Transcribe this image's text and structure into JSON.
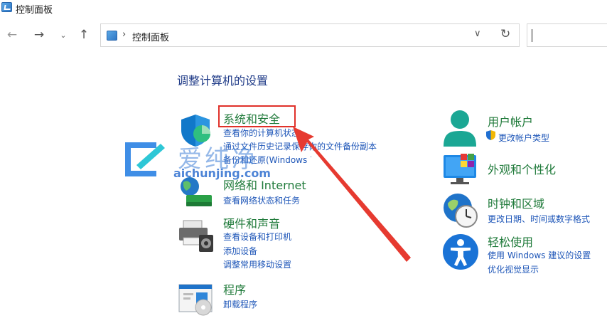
{
  "window": {
    "title": "控制面板"
  },
  "address": {
    "path": "控制面板"
  },
  "heading": "调整计算机的设置",
  "left": [
    {
      "title": "系统和安全",
      "links": [
        "查看你的计算机状态",
        "通过文件历史记录保存你的文件备份副本",
        "备份和还原(Windows 7)"
      ]
    },
    {
      "title": "网络和 Internet",
      "links": [
        "查看网络状态和任务"
      ]
    },
    {
      "title": "硬件和声音",
      "links": [
        "查看设备和打印机",
        "添加设备",
        "调整常用移动设置"
      ]
    },
    {
      "title": "程序",
      "links": [
        "卸载程序"
      ]
    }
  ],
  "right": [
    {
      "title": "用户帐户",
      "links": [
        "更改帐户类型"
      ]
    },
    {
      "title": "外观和个性化",
      "links": []
    },
    {
      "title": "时钟和区域",
      "links": [
        "更改日期、时间或数字格式"
      ]
    },
    {
      "title": "轻松使用",
      "links": [
        "使用 Windows 建议的设置",
        "优化视觉显示"
      ]
    }
  ],
  "watermark": {
    "text": "爱纯净",
    "url": "aichunjing.com"
  },
  "colors": {
    "category": "#1f7a3a",
    "link": "#1e56b8",
    "heading": "#1e3a87",
    "highlight": "#e0312a"
  }
}
